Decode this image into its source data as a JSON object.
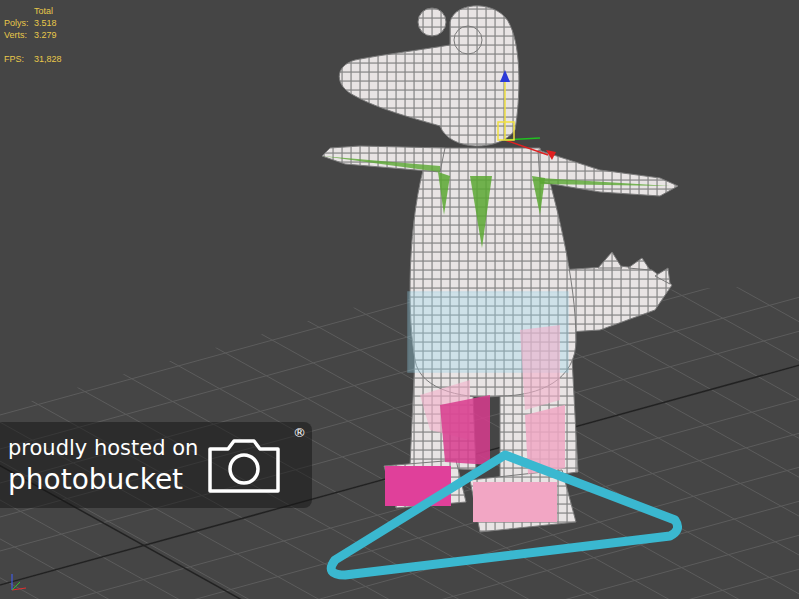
{
  "viewport": {
    "stats": {
      "heading": "Total",
      "rows": [
        {
          "label": "Polys:",
          "value": "3.518"
        },
        {
          "label": "Verts:",
          "value": "3.279"
        },
        {
          "label": "FPS:",
          "value": "31,828"
        }
      ]
    }
  },
  "watermark": {
    "line1": "proudly hosted on",
    "line2": "photobucket",
    "mark": "®"
  }
}
